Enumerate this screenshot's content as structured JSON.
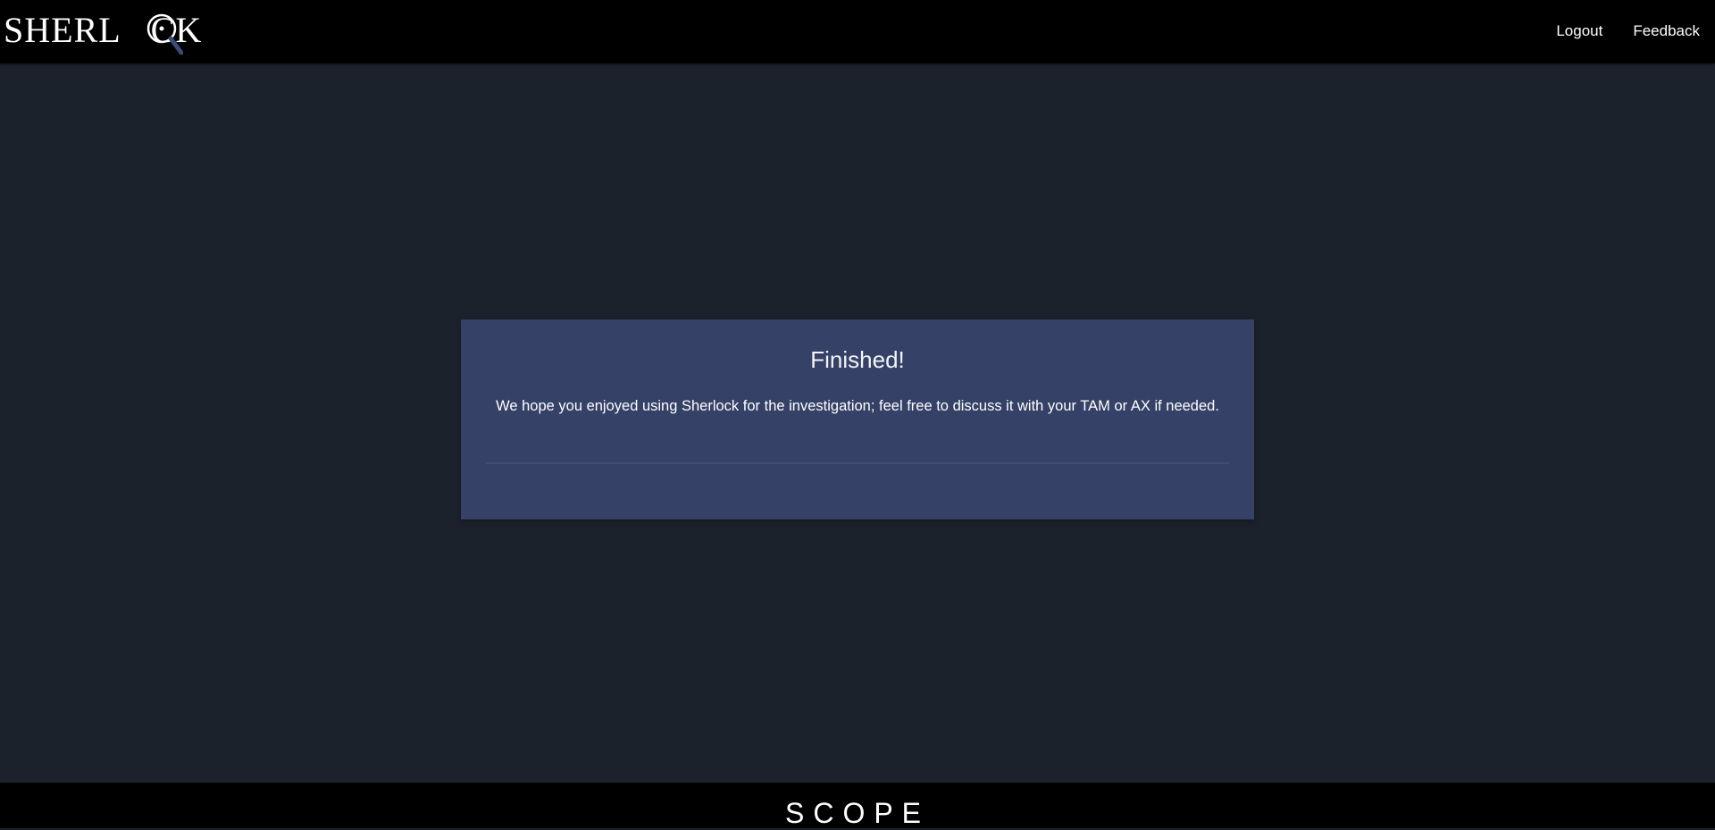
{
  "header": {
    "logo_text": "SHERLOCK",
    "nav": {
      "logout_label": "Logout",
      "feedback_label": "Feedback"
    }
  },
  "main": {
    "card": {
      "title": "Finished!",
      "message": "We hope you enjoyed using Sherlock for the investigation; feel free to discuss it with your TAM or AX if needed."
    }
  },
  "footer": {
    "brand_text": "SCOPE"
  },
  "colors": {
    "page_background": "#1c222c",
    "bar_background": "#000000",
    "card_background": "#354166",
    "lens_accent": "#3a4a7a"
  },
  "icons": {
    "logo_lens": "magnifying-glass-icon"
  }
}
